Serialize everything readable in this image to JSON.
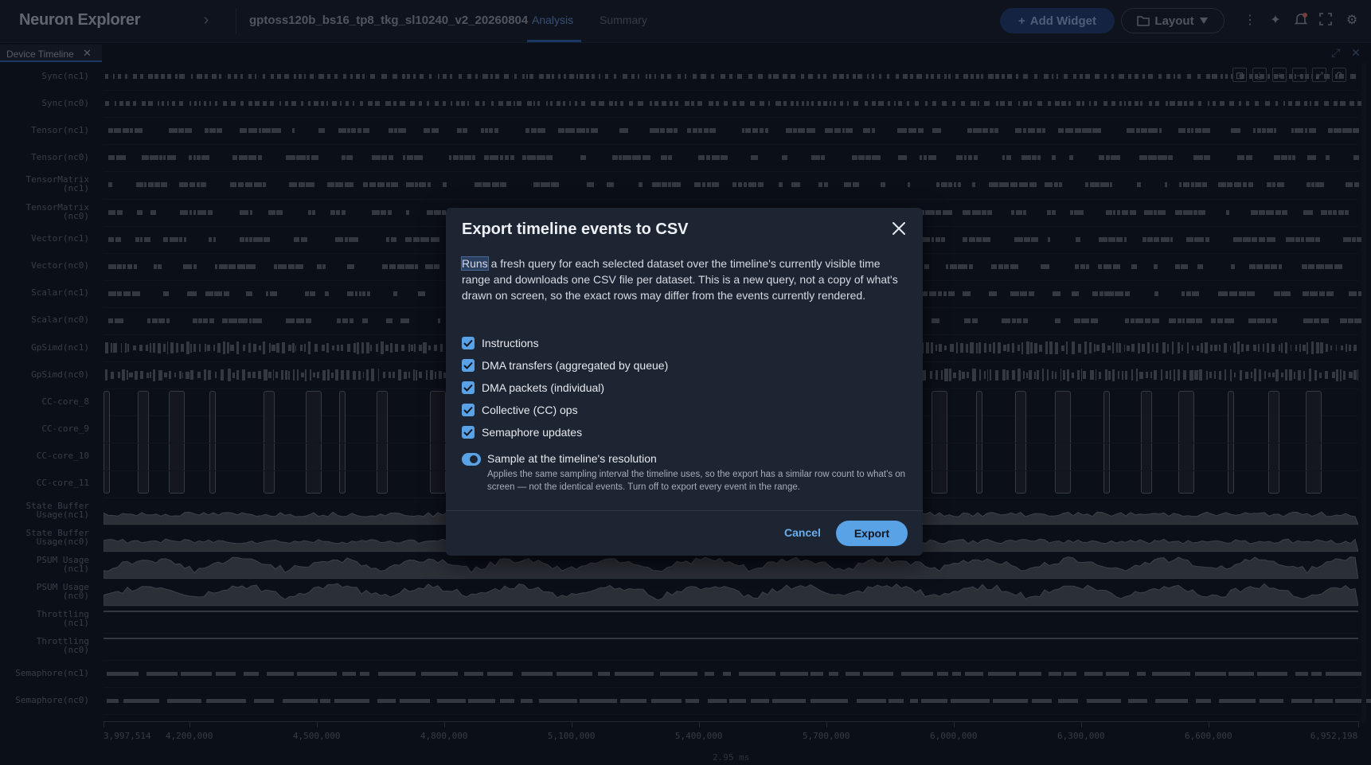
{
  "header": {
    "app_title": "Neuron Explorer",
    "project_name": "gptoss120b_bs16_tp8_tkg_sl10240_v2_20260804",
    "tabs": [
      {
        "label": "Analysis",
        "active": true
      },
      {
        "label": "Summary",
        "active": false
      }
    ],
    "add_widget_label": "Add Widget",
    "layout_label": "Layout"
  },
  "panel": {
    "tab_label": "Device Timeline"
  },
  "timeline": {
    "rows": [
      {
        "label": "Sync(nc1)",
        "kind": "sync"
      },
      {
        "label": "Sync(nc0)",
        "kind": "sync"
      },
      {
        "label": "Tensor(nc1)",
        "kind": "bars"
      },
      {
        "label": "Tensor(nc0)",
        "kind": "bars"
      },
      {
        "label": "TensorMatrix\n(nc1)",
        "kind": "bars"
      },
      {
        "label": "TensorMatrix\n(nc0)",
        "kind": "bars"
      },
      {
        "label": "Vector(nc1)",
        "kind": "bars"
      },
      {
        "label": "Vector(nc0)",
        "kind": "bars"
      },
      {
        "label": "Scalar(nc1)",
        "kind": "bars"
      },
      {
        "label": "Scalar(nc0)",
        "kind": "bars"
      },
      {
        "label": "GpSimd(nc1)",
        "kind": "dense"
      },
      {
        "label": "GpSimd(nc0)",
        "kind": "dense"
      },
      {
        "label": "CC-core_8",
        "kind": "cc"
      },
      {
        "label": "CC-core_9",
        "kind": "cc"
      },
      {
        "label": "CC-core_10",
        "kind": "cc"
      },
      {
        "label": "CC-core_11",
        "kind": "cc"
      },
      {
        "label": "State Buffer\nUsage(nc1)",
        "kind": "area_flat"
      },
      {
        "label": "State Buffer\nUsage(nc0)",
        "kind": "area_flat"
      },
      {
        "label": "PSUM Usage\n(nc1)",
        "kind": "area_wave"
      },
      {
        "label": "PSUM Usage\n(nc0)",
        "kind": "area_wave"
      },
      {
        "label": "Throttling\n(nc1)",
        "kind": "line"
      },
      {
        "label": "Throttling\n(nc0)",
        "kind": "line"
      },
      {
        "label": "Semaphore(nc1)",
        "kind": "sema"
      },
      {
        "label": "Semaphore(nc0)",
        "kind": "sema"
      }
    ],
    "axis_ticks": [
      "3,997,514",
      "4,200,000",
      "4,500,000",
      "4,800,000",
      "5,100,000",
      "5,400,000",
      "5,700,000",
      "6,000,000",
      "6,300,000",
      "6,600,000",
      "6,952,198"
    ],
    "axis_start": 3997514,
    "axis_end": 6952198,
    "duration_label": "2.95 ms"
  },
  "dialog": {
    "title": "Export timeline events to CSV",
    "description_highlight": "Runs",
    "description_rest": " a fresh query for each selected dataset over the timeline's currently visible time range and downloads one CSV file per dataset. This is a new query, not a copy of what's drawn on screen, so the exact rows may differ from the events currently rendered.",
    "options": [
      {
        "label": "Instructions",
        "checked": true
      },
      {
        "label": "DMA transfers (aggregated by queue)",
        "checked": true
      },
      {
        "label": "DMA packets (individual)",
        "checked": true
      },
      {
        "label": "Collective (CC) ops",
        "checked": true
      },
      {
        "label": "Semaphore updates",
        "checked": true
      }
    ],
    "sample_toggle": {
      "label": "Sample at the timeline's resolution",
      "enabled": true,
      "help": "Applies the same sampling interval the timeline uses, so the export has a similar row count to what's on screen — not the identical events. Turn off to export every event in the range."
    },
    "cancel_label": "Cancel",
    "export_label": "Export"
  },
  "colors": {
    "accent": "#5aa2e6",
    "background": "#10151f",
    "dialog_bg": "#1d2532"
  }
}
